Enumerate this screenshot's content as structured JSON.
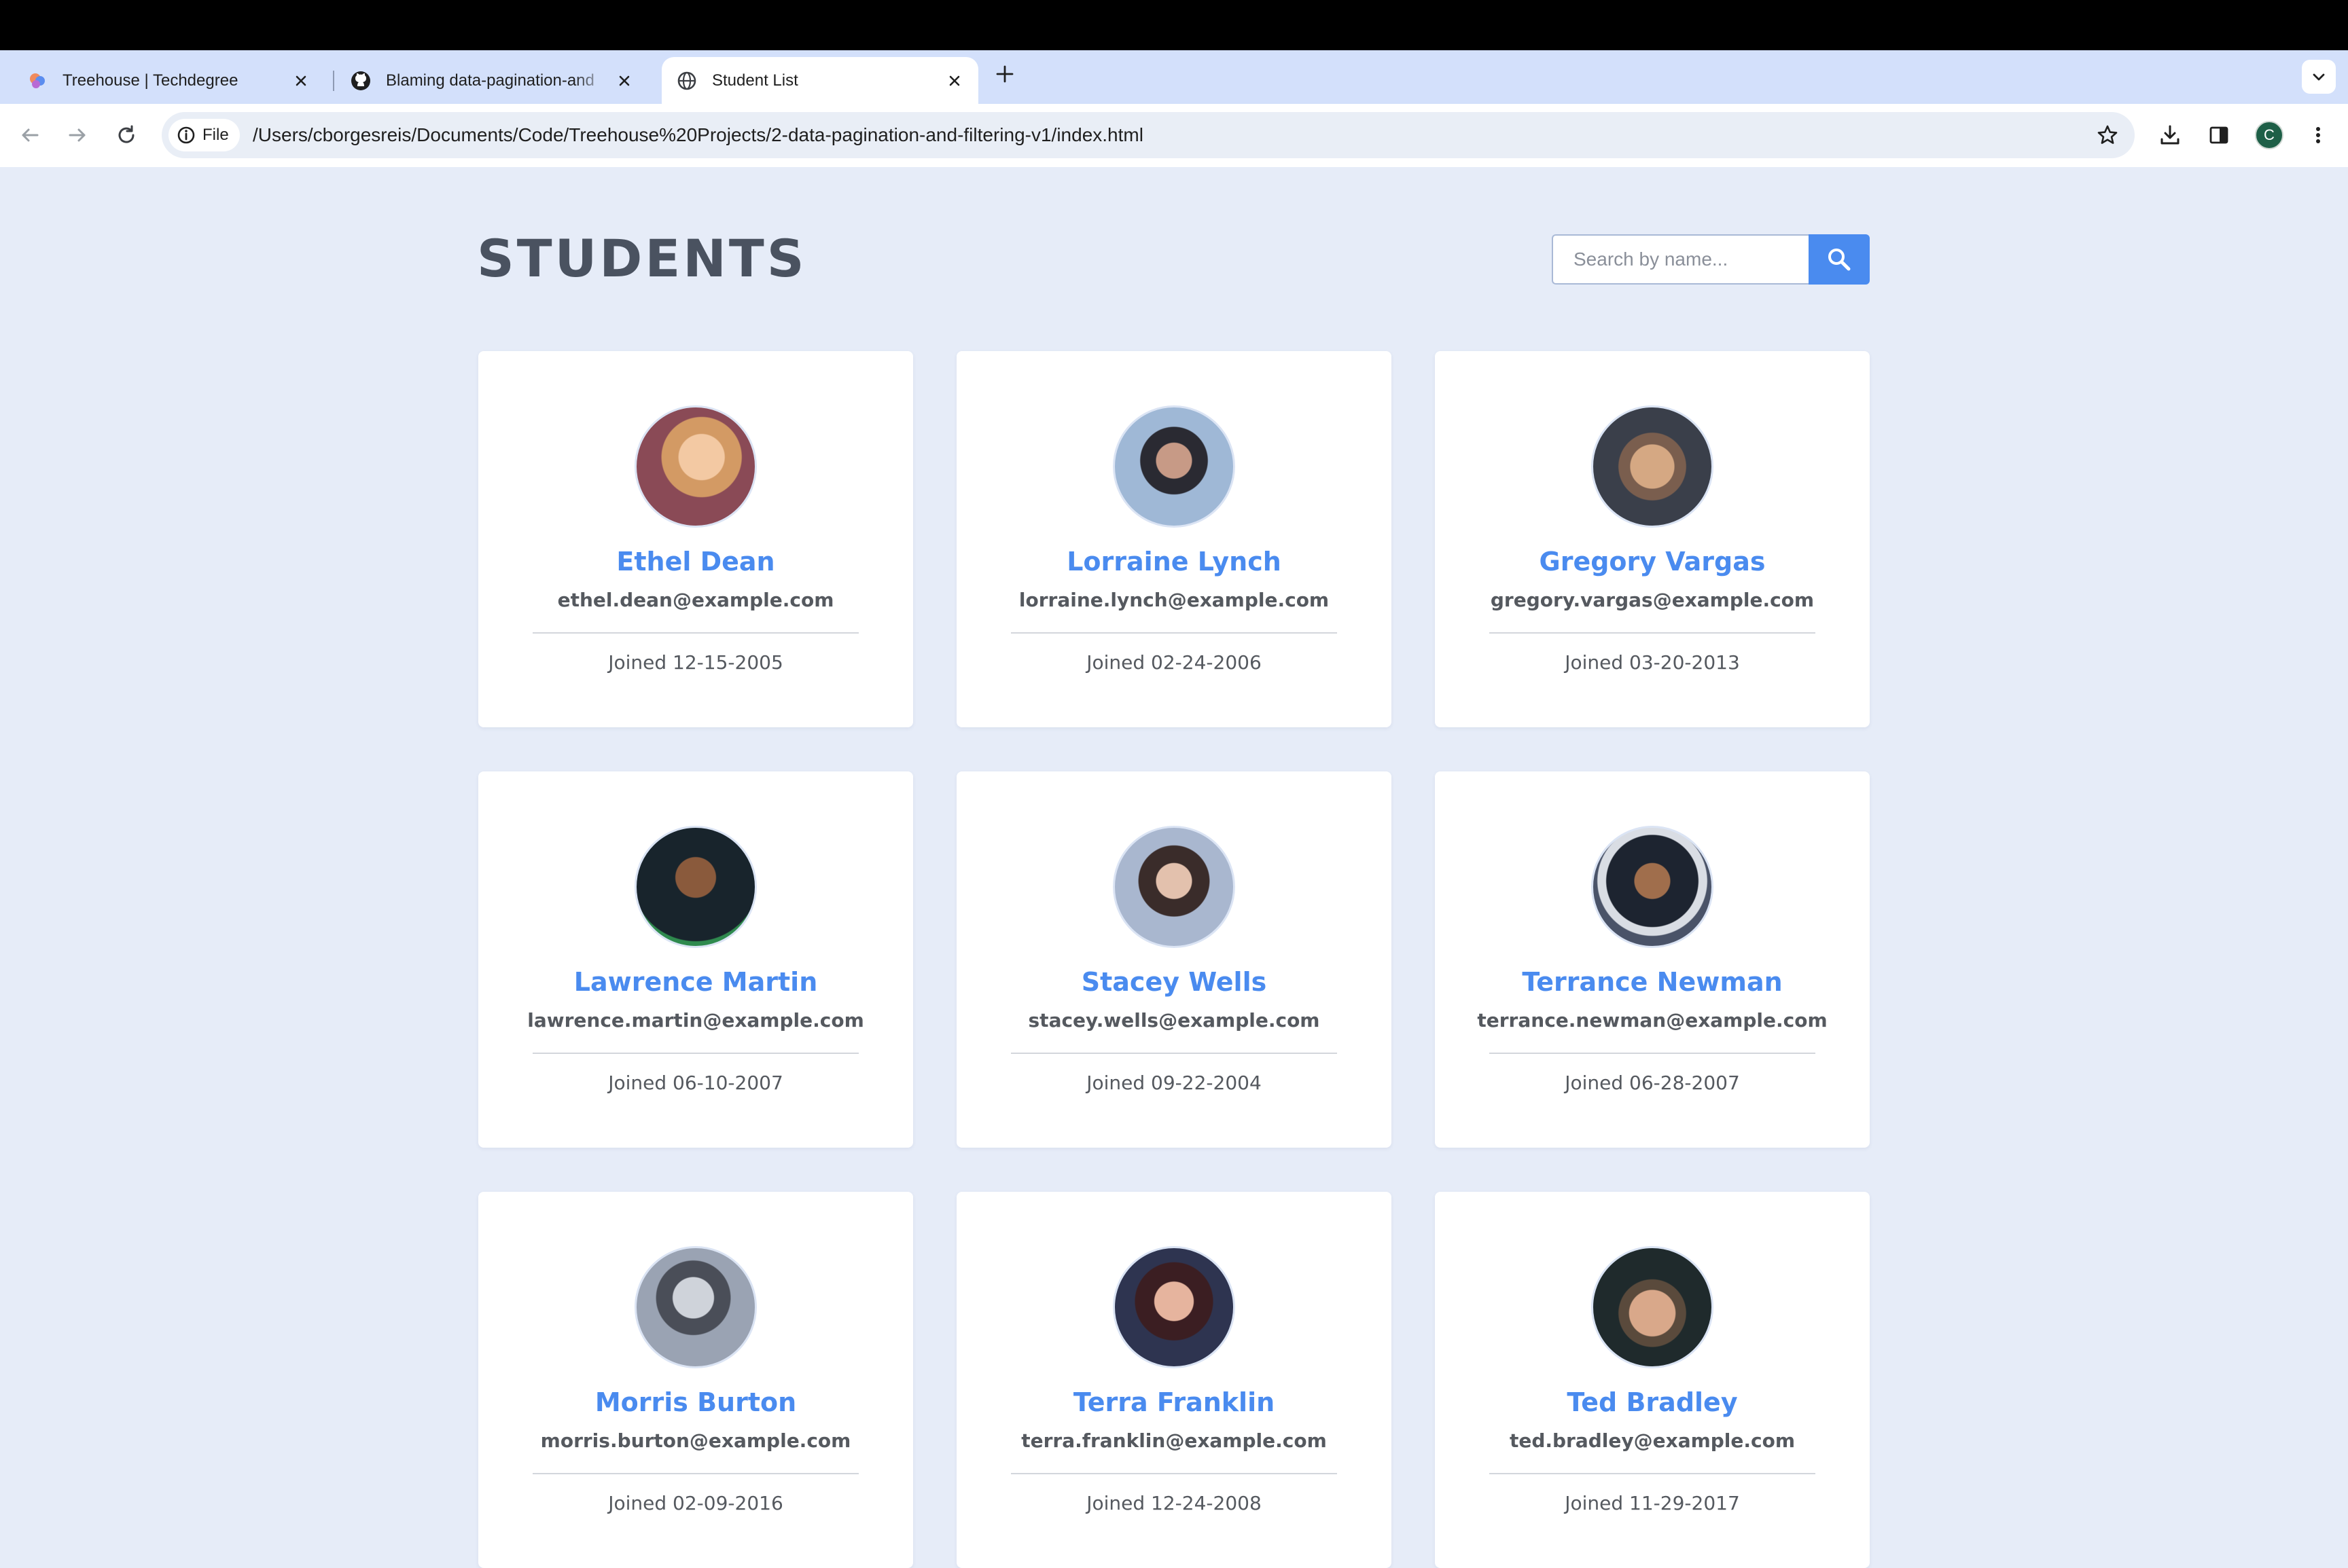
{
  "browser": {
    "tabs": [
      {
        "title": "Treehouse | Techdegree",
        "icon": "treehouse-icon",
        "active": false
      },
      {
        "title": "Blaming data-pagination-and",
        "icon": "github-icon",
        "active": false
      },
      {
        "title": "Student List",
        "icon": "globe-icon",
        "active": true
      }
    ],
    "address_chip": "File",
    "url": "/Users/cborgesreis/Documents/Code/Treehouse%20Projects/2-data-pagination-and-filtering-v1/index.html",
    "profile_initial": "C",
    "profile_color": "#1e5f47"
  },
  "page": {
    "title": "STUDENTS",
    "search": {
      "placeholder": "Search by name...",
      "value": ""
    },
    "accent_color": "#4a8bef",
    "students": [
      {
        "name": "Ethel Dean",
        "email": "ethel.dean@example.com",
        "joined": "Joined 12-15-2005"
      },
      {
        "name": "Lorraine Lynch",
        "email": "lorraine.lynch@example.com",
        "joined": "Joined 02-24-2006"
      },
      {
        "name": "Gregory Vargas",
        "email": "gregory.vargas@example.com",
        "joined": "Joined 03-20-2013"
      },
      {
        "name": "Lawrence Martin",
        "email": "lawrence.martin@example.com",
        "joined": "Joined 06-10-2007"
      },
      {
        "name": "Stacey Wells",
        "email": "stacey.wells@example.com",
        "joined": "Joined 09-22-2004"
      },
      {
        "name": "Terrance Newman",
        "email": "terrance.newman@example.com",
        "joined": "Joined 06-28-2007"
      },
      {
        "name": "Morris Burton",
        "email": "morris.burton@example.com",
        "joined": "Joined 02-09-2016"
      },
      {
        "name": "Terra Franklin",
        "email": "terra.franklin@example.com",
        "joined": "Joined 12-24-2008"
      },
      {
        "name": "Ted Bradley",
        "email": "ted.bradley@example.com",
        "joined": "Joined 11-29-2017"
      }
    ]
  }
}
